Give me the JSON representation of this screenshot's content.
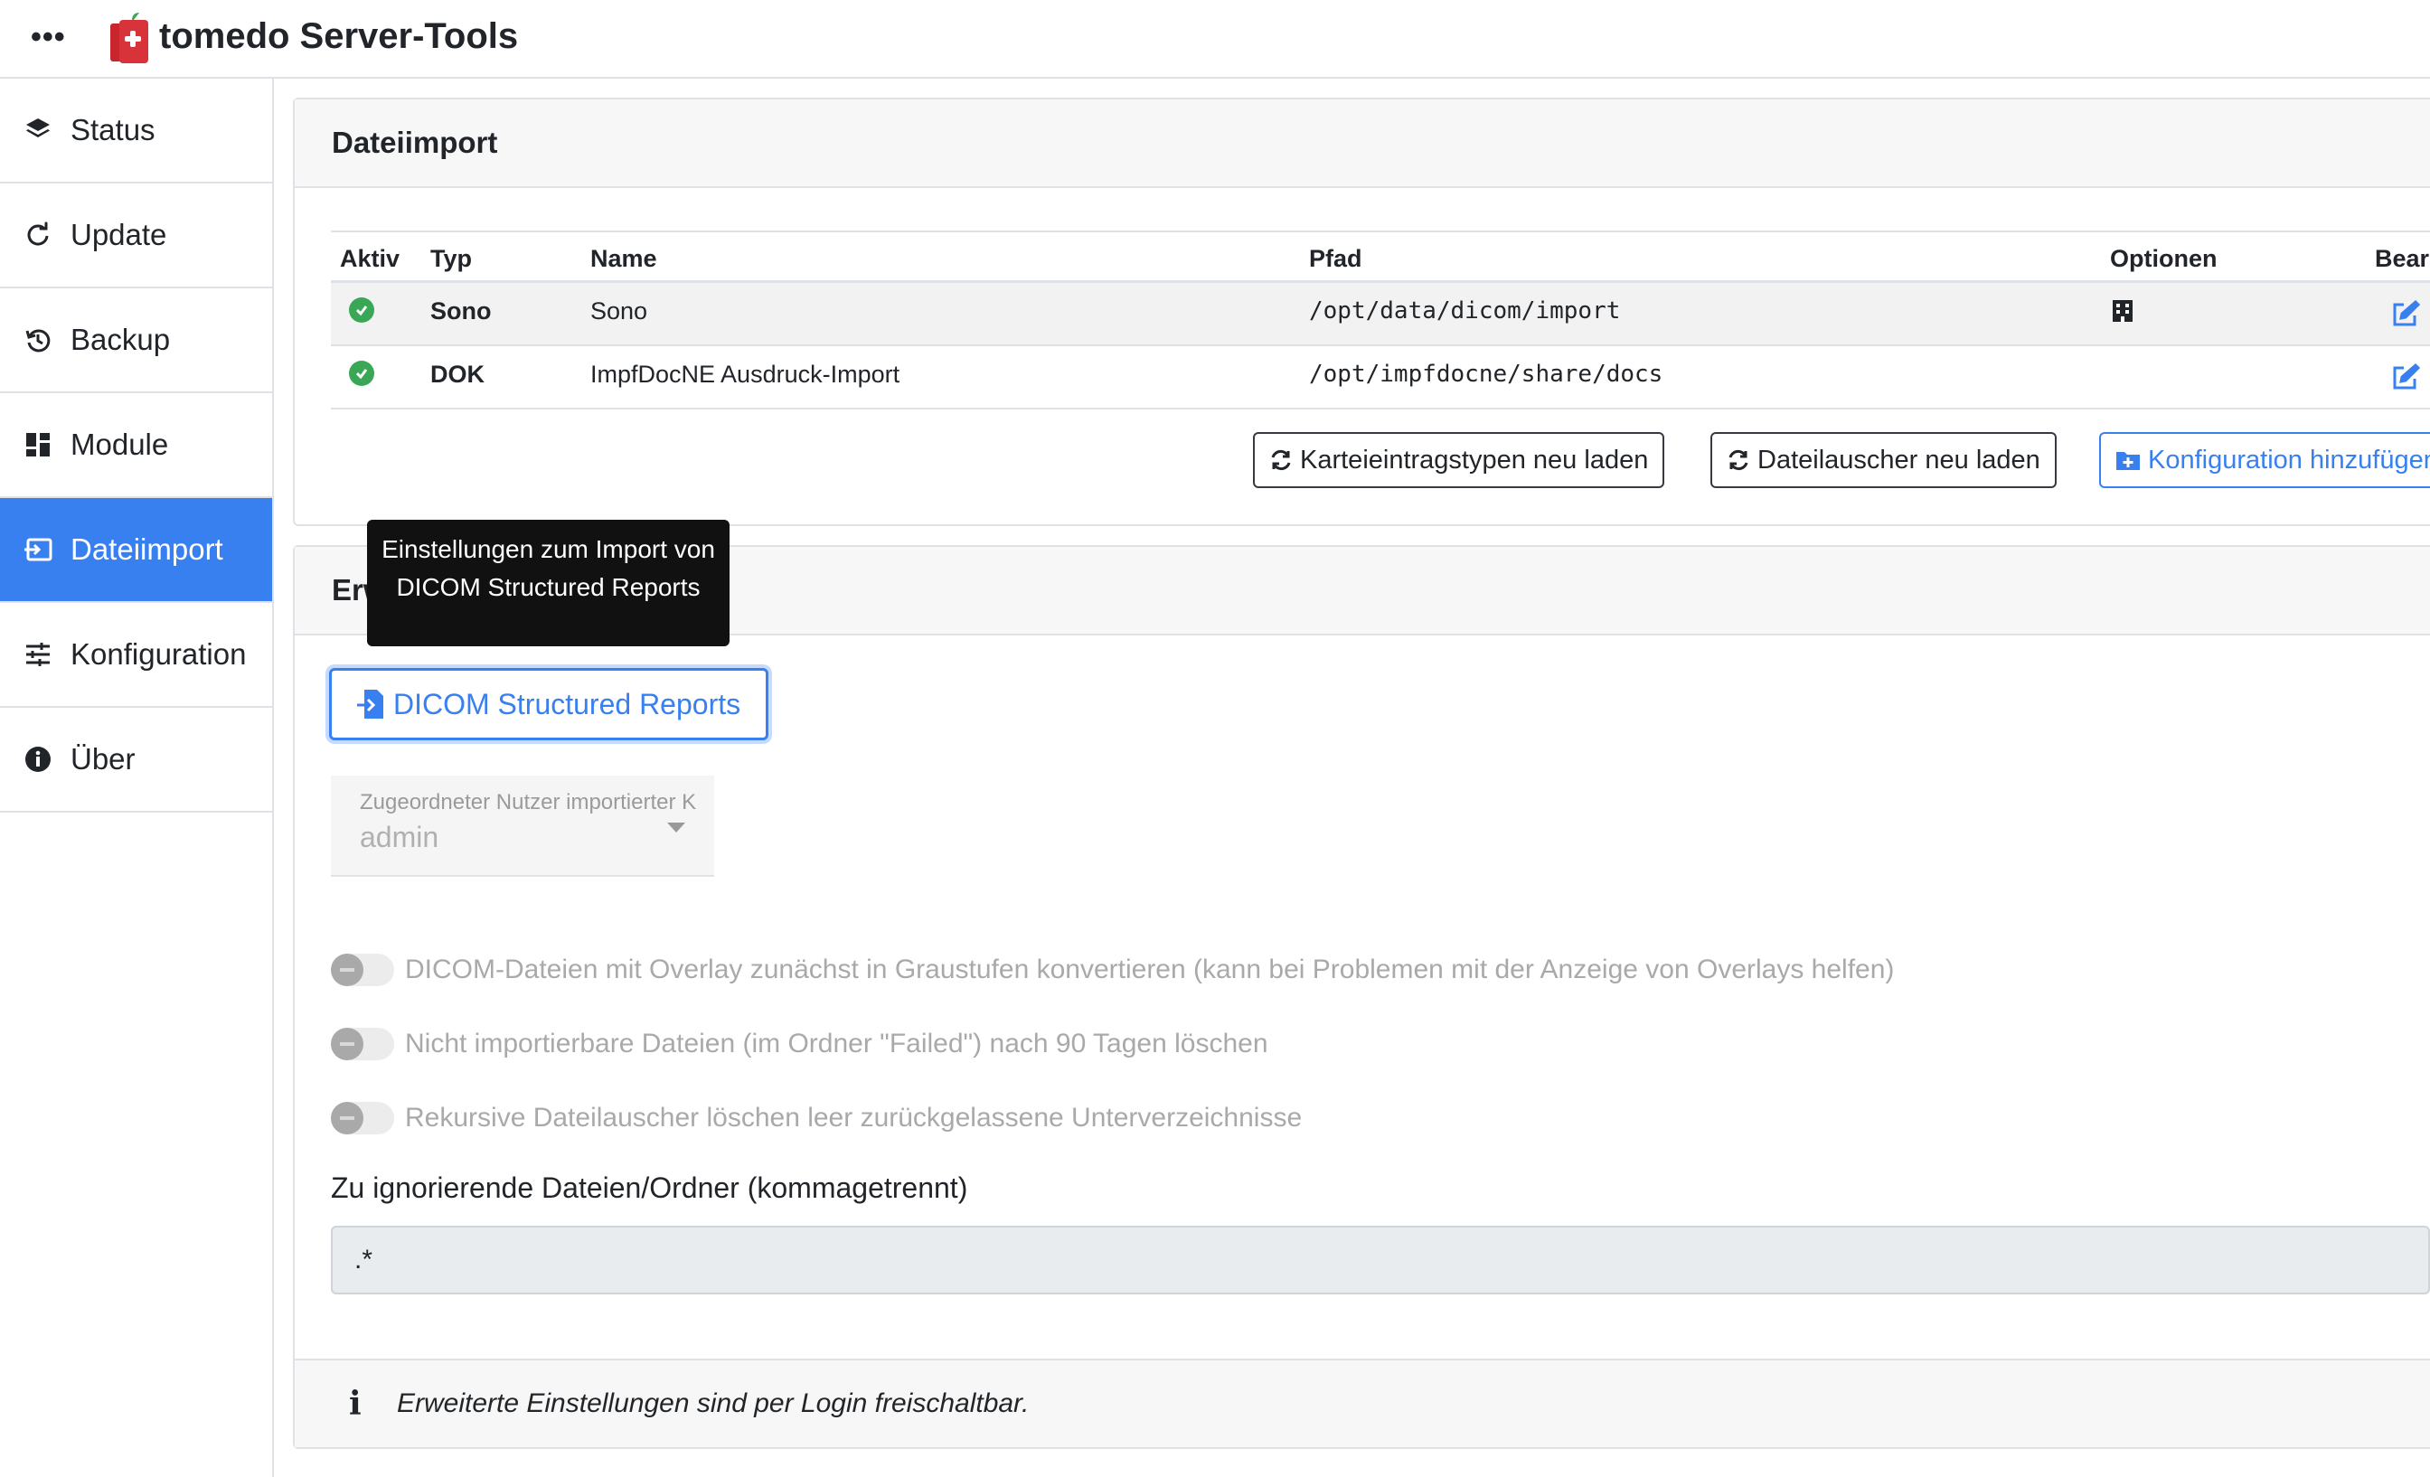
{
  "app": {
    "title": "tomedo Server-Tools",
    "menu_icon": "ellipsis-icon",
    "logo_icon": "tomedo-logo-icon",
    "accent_color": "#3880ef"
  },
  "sidebar": {
    "items": [
      {
        "label": "Status",
        "icon": "layers-icon"
      },
      {
        "label": "Update",
        "icon": "refresh-icon"
      },
      {
        "label": "Backup",
        "icon": "history-icon"
      },
      {
        "label": "Module",
        "icon": "grid-icon"
      },
      {
        "label": "Dateiimport",
        "icon": "import-icon",
        "active": true
      },
      {
        "label": "Konfiguration",
        "icon": "sliders-icon"
      },
      {
        "label": "Über",
        "icon": "info-icon"
      }
    ]
  },
  "dateiimport": {
    "title": "Dateiimport",
    "columns": [
      "Aktiv",
      "Typ",
      "Name",
      "Pfad",
      "Optionen",
      "Bearb"
    ],
    "rows": [
      {
        "typ": "Sono",
        "name": "Sono",
        "pfad": "/opt/data/dicom/import",
        "optionen_icon": "building-icon"
      },
      {
        "typ": "DOK",
        "name": "ImpfDocNE Ausdruck-Import",
        "pfad": "/opt/impfdocne/share/docs"
      }
    ],
    "buttons": {
      "reload_types": "Karteieintragstypen neu laden",
      "reload_watchers": "Dateilauscher neu laden",
      "add_config": "Konfiguration hinzufügen"
    }
  },
  "erweitert": {
    "title_visible_start": "Erw",
    "tooltip": "Einstellungen zum Import von DICOM Structured Reports",
    "sr_button": "DICOM Structured Reports",
    "select": {
      "label": "Zugeordneter Nutzer importierter K",
      "value": "admin"
    },
    "toggles": [
      {
        "label": "DICOM-Dateien mit Overlay zunächst in Graustufen konvertieren (kann bei Problemen mit der Anzeige von Overlays helfen)",
        "on": false
      },
      {
        "label": "Nicht importierbare Dateien (im Ordner \"Failed\") nach 90 Tagen löschen",
        "on": false
      },
      {
        "label": "Rekursive Dateilauscher löschen leer zurückgelassene Unterverzeichnisse",
        "on": false
      }
    ],
    "ignore_label": "Zu ignorierende Dateien/Ordner (kommagetrennt)",
    "ignore_value": ".*",
    "footer": "Erweiterte Einstellungen sind per Login freischaltbar."
  }
}
